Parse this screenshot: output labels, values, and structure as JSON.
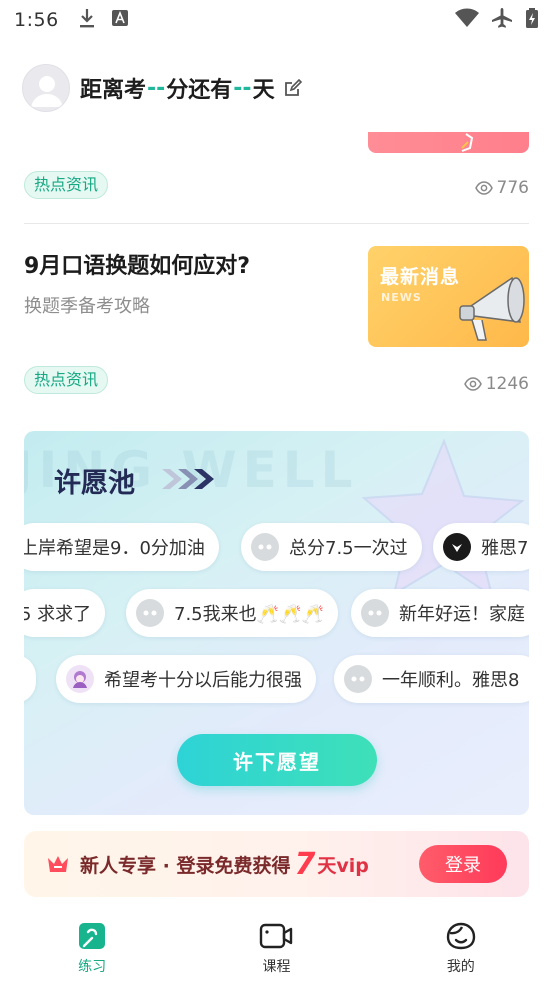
{
  "status_bar": {
    "time": "1:56",
    "left_icons": [
      "download-icon",
      "keyboard-a-icon"
    ],
    "right_icons": [
      "wifi-icon",
      "airplane-icon",
      "battery-charging-icon"
    ]
  },
  "header": {
    "title_prefix": "距离考",
    "dash1": "--",
    "title_middle": "分还有",
    "dash2": "--",
    "title_suffix": "天"
  },
  "feed": [
    {
      "tag": "热点资讯",
      "views": "776"
    },
    {
      "title": "9月口语换题如何应对?",
      "subtitle": "换题季备考攻略",
      "thumb_title": "最新消息",
      "thumb_sub": "NEWS",
      "tag": "热点资讯",
      "views": "1246"
    }
  ],
  "wish_pool": {
    "title": "许愿池",
    "bg_text": "JING WELL",
    "row1": [
      "上岸希望是9．0分加油",
      "总分7.5一次过",
      "雅思7"
    ],
    "row2": [
      "5 求求了",
      "7.5我来也🥂🥂🥂",
      "新年好运！家庭"
    ],
    "row3": [
      "",
      "希望考十分以后能力很强",
      "一年顺利。雅思8"
    ],
    "button": "许下愿望"
  },
  "promo": {
    "part1": "新人专享 · 登录免费获得",
    "days": "7",
    "part2": "天vip",
    "button": "登录"
  },
  "bottom_nav": [
    {
      "label": "练习",
      "icon": "practice-icon",
      "active": true
    },
    {
      "label": "课程",
      "icon": "video-course-icon",
      "active": false
    },
    {
      "label": "我的",
      "icon": "profile-face-icon",
      "active": false
    }
  ],
  "colors": {
    "accent": "#17a884",
    "promo_red": "#ff3b4e",
    "wish_button": "#2ed3d6"
  }
}
